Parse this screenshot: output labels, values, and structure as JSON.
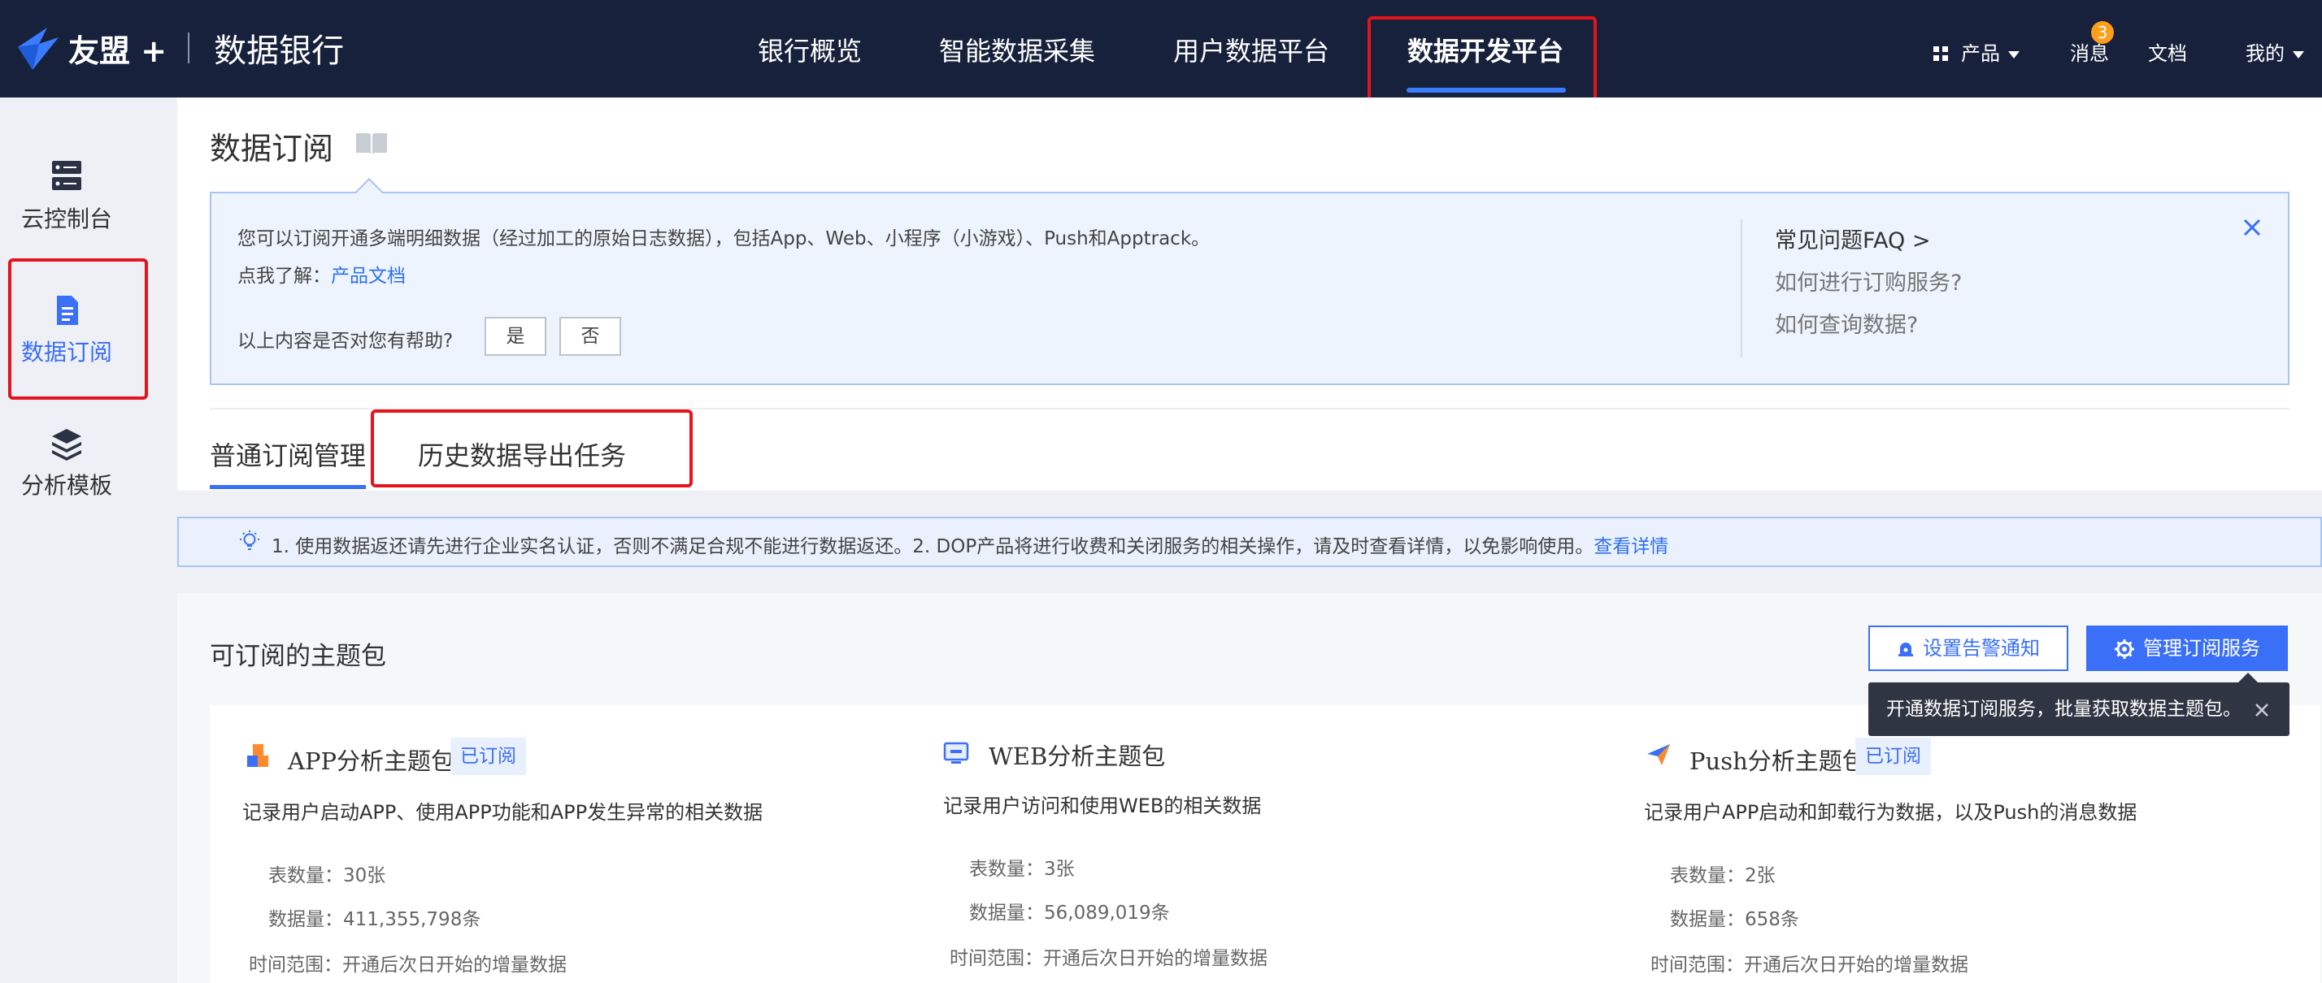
{
  "topbar": {
    "brand": "友盟 +",
    "product": "数据银行",
    "nav": [
      "银行概览",
      "智能数据采集",
      "用户数据平台",
      "数据开发平台"
    ],
    "products_label": "产品",
    "messages_label": "消息",
    "messages_count": "3",
    "docs_label": "文档",
    "mine_label": "我的"
  },
  "sidebar": {
    "items": [
      {
        "label": "云控制台",
        "icon": "server-icon"
      },
      {
        "label": "数据订阅",
        "icon": "document-icon"
      },
      {
        "label": "分析模板",
        "icon": "layers-icon"
      }
    ]
  },
  "page": {
    "title": "数据订阅",
    "info": {
      "line1": "您可以订阅开通多端明细数据（经过加工的原始日志数据），包括App、Web、小程序（小游戏）、Push和Apptrack。",
      "learn_prefix": "点我了解：",
      "learn_link": "产品文档",
      "helpful_q": "以上内容是否对您有帮助?",
      "yes": "是",
      "no": "否",
      "faq_title": "常见问题FAQ >",
      "faq_q1": "如何进行订购服务?",
      "faq_q2": "如何查询数据?"
    },
    "tabs": [
      "普通订阅管理",
      "历史数据导出任务"
    ],
    "notice": {
      "text": "1. 使用数据返还请先进行企业实名认证，否则不满足合规不能进行数据返还。2. DOP产品将进行收费和关闭服务的相关操作，请及时查看详情，以免影响使用。",
      "link": "查看详情"
    }
  },
  "packages": {
    "title": "可订阅的主题包",
    "alert_button": "设置告警通知",
    "manage_button": "管理订阅服务",
    "tooltip": "开通数据订阅服务，批量获取数据主题包。",
    "cards": [
      {
        "name": "APP分析主题包",
        "tag": "已订阅",
        "desc": "记录用户启动APP、使用APP功能和APP发生异常的相关数据",
        "tables_label": "表数量：",
        "tables": "30张",
        "rows_label": "数据量：",
        "rows": "411,355,798条",
        "range_label": "时间范围：",
        "range": "开通后次日开始的增量数据"
      },
      {
        "name": "WEB分析主题包",
        "tag": "",
        "desc": "记录用户访问和使用WEB的相关数据",
        "tables_label": "表数量：",
        "tables": "3张",
        "rows_label": "数据量：",
        "rows": "56,089,019条",
        "range_label": "时间范围：",
        "range": "开通后次日开始的增量数据"
      },
      {
        "name": "Push分析主题包",
        "tag": "已订阅",
        "desc": "记录用户APP启动和卸载行为数据，以及Push的消息数据",
        "tables_label": "表数量：",
        "tables": "2张",
        "rows_label": "数据量：",
        "rows": "658条",
        "range_label": "时间范围：",
        "range": "开通后次日开始的增量数据"
      }
    ]
  },
  "colors": {
    "nav_bg": "#17213b",
    "accent": "#3a6ff7",
    "highlight": "#e3141b"
  }
}
